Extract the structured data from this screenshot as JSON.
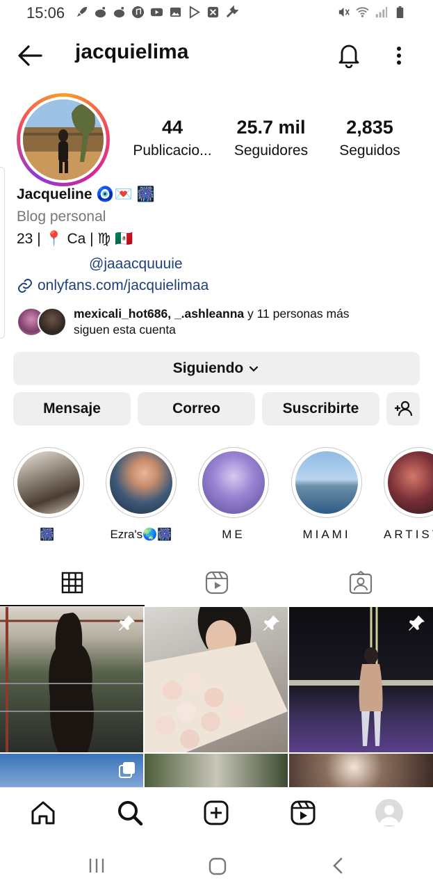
{
  "status_bar": {
    "time": "15:06"
  },
  "header": {
    "username": "jacquielima"
  },
  "stats": [
    {
      "num": "44",
      "label": "Publicacio..."
    },
    {
      "num": "25.7 mil",
      "label": "Seguidores"
    },
    {
      "num": "2,835",
      "label": "Seguidos"
    }
  ],
  "bio": {
    "name": "Jacqueline 🧿💌 🎆",
    "category": "Blog personal",
    "line1": "23 | 📍 Ca |  ♍ 🇲🇽",
    "mention": "@jaaacquuuie",
    "link": "onlyfans.com/jacquielimaa"
  },
  "followed_by": {
    "names": "mexicali_hot686, _.ashleanna",
    "rest": " y 11 personas más",
    "line2": "siguen esta cuenta"
  },
  "buttons": {
    "following": "Siguiendo",
    "message": "Mensaje",
    "email": "Correo",
    "subscribe": "Suscribirte"
  },
  "highlights": [
    {
      "label": "🎆"
    },
    {
      "label": "Ezra's🌏🎆"
    },
    {
      "label": "ME"
    },
    {
      "label": "MIAMI"
    },
    {
      "label": "ARTIST"
    }
  ],
  "colors": {
    "link": "#1f3f7a",
    "button_bg": "#efefef",
    "secondary_text": "#777777"
  }
}
